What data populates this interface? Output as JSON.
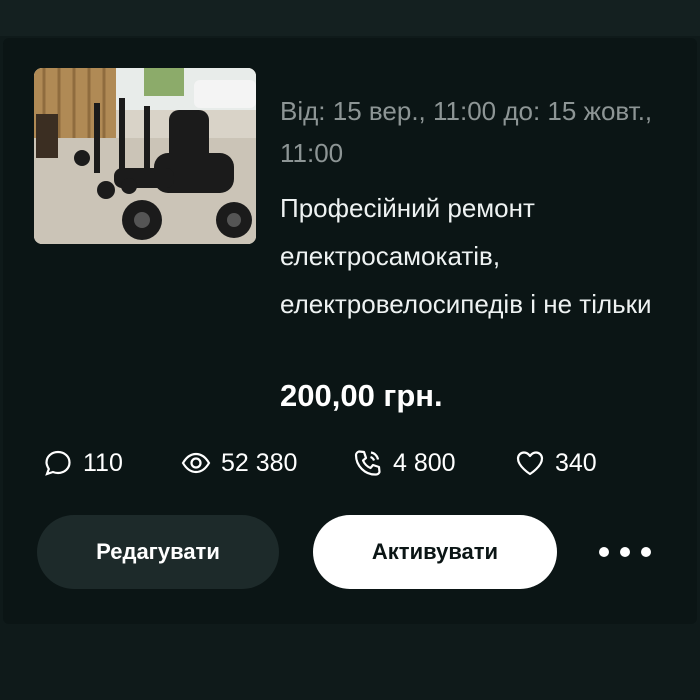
{
  "listing": {
    "period": "Від: 15 вер., 11:00 до: 15 жовт., 11:00",
    "title": "Професійний ремонт електросамокатів, електровелосипедів і не тільки",
    "price": "200,00 грн."
  },
  "stats": {
    "messages": "110",
    "views": "52 380",
    "calls": "4 800",
    "favorites": "340"
  },
  "icons": {
    "messages": "chat-bubble-icon",
    "views": "eye-icon",
    "calls": "phone-icon",
    "favorites": "heart-icon",
    "more": "more-dots-icon"
  },
  "actions": {
    "edit_label": "Редагувати",
    "activate_label": "Активувати"
  },
  "colors": {
    "background": "#0f1a1a",
    "card": "#0b1515",
    "muted_text": "#8d9595",
    "secondary_button": "#1d2a2a",
    "primary_button": "#ffffff"
  }
}
